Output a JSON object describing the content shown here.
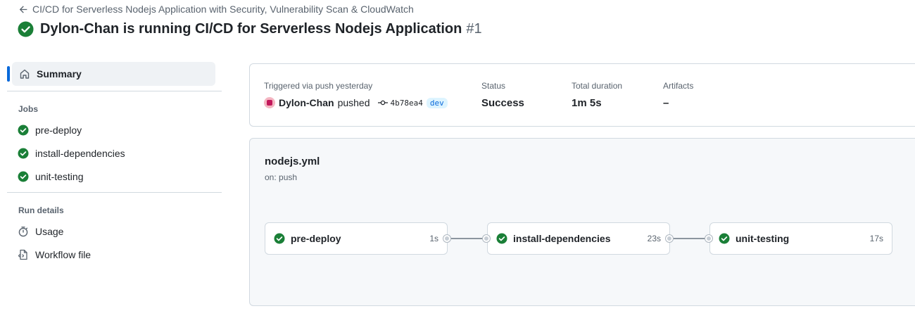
{
  "header": {
    "back_label": "CI/CD for Serverless Nodejs Application with Security, Vulnerability Scan & CloudWatch",
    "title": "Dylon-Chan is running CI/CD for Serverless Nodejs Application",
    "run_number": "#1"
  },
  "sidebar": {
    "summary_label": "Summary",
    "jobs_heading": "Jobs",
    "jobs": [
      {
        "label": "pre-deploy"
      },
      {
        "label": "install-dependencies"
      },
      {
        "label": "unit-testing"
      }
    ],
    "run_details_heading": "Run details",
    "usage_label": "Usage",
    "workflow_file_label": "Workflow file"
  },
  "summary": {
    "trigger_label": "Triggered via push yesterday",
    "actor": "Dylon-Chan",
    "action": "pushed",
    "commit": "4b78ea4",
    "branch": "dev",
    "status_label": "Status",
    "status_value": "Success",
    "duration_label": "Total duration",
    "duration_value": "1m 5s",
    "artifacts_label": "Artifacts",
    "artifacts_value": "–"
  },
  "workflow": {
    "file": "nodejs.yml",
    "trigger": "on: push",
    "jobs": [
      {
        "name": "pre-deploy",
        "duration": "1s"
      },
      {
        "name": "install-dependencies",
        "duration": "23s"
      },
      {
        "name": "unit-testing",
        "duration": "17s"
      }
    ]
  },
  "colors": {
    "success": "#1a7f37",
    "accent": "#0969da"
  }
}
